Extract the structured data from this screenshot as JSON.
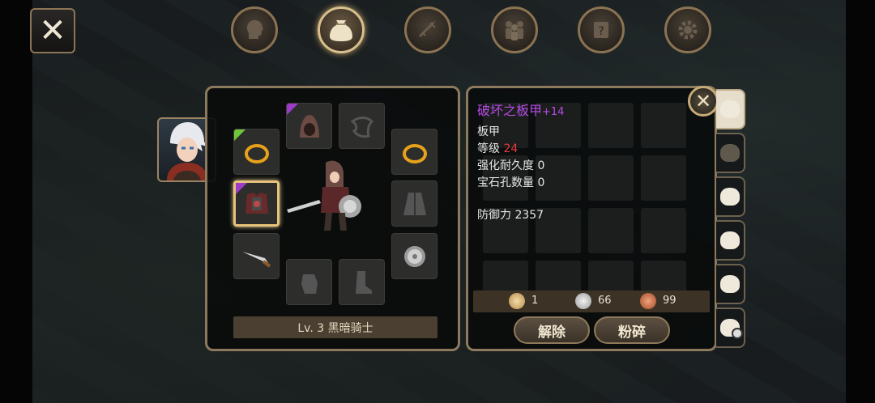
{
  "buttons": {
    "close_label": "✕"
  },
  "tabs": [
    {
      "icon": "head-icon",
      "glyph": "☻"
    },
    {
      "icon": "bag-icon",
      "glyph": "♣",
      "active": true
    },
    {
      "icon": "sword-icon",
      "glyph": "✦"
    },
    {
      "icon": "party-icon",
      "glyph": "♟"
    },
    {
      "icon": "scroll-icon",
      "glyph": "?"
    },
    {
      "icon": "gear-icon",
      "glyph": "⚙"
    }
  ],
  "equipment": {
    "level_label": "Lv. 3 黑暗骑士"
  },
  "item": {
    "name": "破坏之板甲",
    "plus": "+14",
    "type": "板甲",
    "level_label": "等级",
    "level_value": "24",
    "durability": "强化耐久度 0",
    "gems": "宝石孔数量 0",
    "defense": "防御力 2357"
  },
  "currency": {
    "gold": "1",
    "silver": "66",
    "copper": "99"
  },
  "actions": {
    "release": "解除",
    "shatter": "粉碎"
  },
  "colors": {
    "accent": "#8d7a5e",
    "epic": "#b74ae6",
    "rare": "#6fc63a"
  }
}
